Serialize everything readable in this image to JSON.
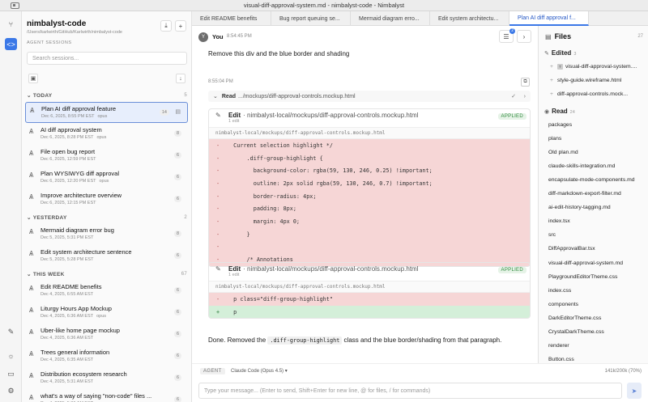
{
  "window": {
    "title": "visual-diff-approval-system.md - nimbalyst-code - Nimbalyst"
  },
  "rail": {
    "icons": [
      "workflow-icon",
      "code-icon",
      "edit-icon",
      "sun-icon",
      "feedback-icon",
      "gear-icon"
    ]
  },
  "sidebar": {
    "project_title": "nimbalyst-code",
    "project_path": "/Users/karlwirth/GitHub/Karlwirth/nimbalyst-code",
    "section_caption": "AGENT SESSIONS",
    "search_placeholder": "Search sessions...",
    "groups": [
      {
        "label": "TODAY",
        "count": "5",
        "sessions": [
          {
            "title": "Plan AI diff approval feature",
            "date": "Dec 6, 2025, 8:55 PM EST",
            "model": "opus",
            "badge": "14",
            "selected": true
          },
          {
            "title": "AI diff approval system",
            "date": "Dec 6, 2025, 8:28 PM EST",
            "model": "opus",
            "badge": "8"
          },
          {
            "title": "File open bug report",
            "date": "Dec 6, 2025, 12:59 PM EST",
            "model": "",
            "badge": "6"
          },
          {
            "title": "Plan WYSIWYG diff approval",
            "date": "Dec 6, 2025, 12:20 PM EST",
            "model": "opus",
            "badge": "6"
          },
          {
            "title": "Improve architecture overview",
            "date": "Dec 6, 2025, 12:15 PM EST",
            "model": "",
            "badge": "6"
          }
        ]
      },
      {
        "label": "YESTERDAY",
        "count": "2",
        "sessions": [
          {
            "title": "Mermaid diagram error bug",
            "date": "Dec 5, 2025, 5:31 PM EST",
            "model": "",
            "badge": "8"
          },
          {
            "title": "Edit system architecture sentence",
            "date": "Dec 5, 2025, 5:28 PM EST",
            "model": "",
            "badge": "6"
          }
        ]
      },
      {
        "label": "THIS WEEK",
        "count": "67",
        "sessions": [
          {
            "title": "Edit README benefits",
            "date": "Dec 4, 2025, 6:55 AM EST",
            "model": "",
            "badge": "6"
          },
          {
            "title": "Liturgy Hours App Mockup",
            "date": "Dec 4, 2025, 6:36 AM EST",
            "model": "opus",
            "badge": "6"
          },
          {
            "title": "Uber-like home page mockup",
            "date": "Dec 4, 2025, 6:36 AM EST",
            "model": "",
            "badge": "6"
          },
          {
            "title": "Trees general information",
            "date": "Dec 4, 2025, 6:35 AM EST",
            "model": "",
            "badge": "6"
          },
          {
            "title": "Distribution ecosystem research",
            "date": "Dec 4, 2025, 5:31 AM EST",
            "model": "",
            "badge": "6"
          },
          {
            "title": "what's a way of saying \"non-code\" files ...",
            "date": "Dec 4, 2025, 5:36 AM EST",
            "model": "",
            "badge": "6"
          }
        ]
      }
    ]
  },
  "tabs": [
    "Edit README benefits",
    "Bug report queuing se...",
    "Mermaid diagram erro...",
    "Edit system architectu...",
    "Plan AI diff approval f..."
  ],
  "chat": {
    "user_avatar": "Y",
    "user_name": "You",
    "user_time": "8:54:45 PM",
    "header_badge": "2",
    "user_message": "Remove this div and the blue border and shading",
    "assistant_time": "8:55:04 PM",
    "read": {
      "label": "Read",
      "path": ".../mockups/diff-approval-controls.mockup.html"
    },
    "edits": [
      {
        "label": "Edit",
        "path": "nimbalyst-local/mockups/diff-approval-controls.mockup.html",
        "sub": "1 edit",
        "status": "APPLIED",
        "file": "nimbalyst-local/mockups/diff-approval-controls.mockup.html",
        "lines": [
          {
            "t": "del",
            "s": "-",
            "c": "  Current selection highlight */"
          },
          {
            "t": "del",
            "s": "-",
            "c": "      .diff-group-highlight {"
          },
          {
            "t": "del",
            "s": "-",
            "c": "        background-color: rgba(59, 130, 246, 0.25) !important;"
          },
          {
            "t": "del",
            "s": "-",
            "c": "        outline: 2px solid rgba(59, 130, 246, 0.7) !important;"
          },
          {
            "t": "del",
            "s": "-",
            "c": "        border-radius: 4px;"
          },
          {
            "t": "del",
            "s": "-",
            "c": "        padding: 8px;"
          },
          {
            "t": "del",
            "s": "-",
            "c": "        margin: 4px 0;"
          },
          {
            "t": "del",
            "s": "-",
            "c": "      }"
          },
          {
            "t": "del",
            "s": "-",
            "c": ""
          },
          {
            "t": "del",
            "s": "-",
            "c": "      /* Annotations"
          }
        ]
      },
      {
        "label": "Edit",
        "path": "nimbalyst-local/mockups/diff-approval-controls.mockup.html",
        "sub": "1 edit",
        "status": "APPLIED",
        "file": "nimbalyst-local/mockups/diff-approval-controls.mockup.html",
        "lines": [
          {
            "t": "del",
            "s": "-",
            "c": "  p class=\"diff-group-highlight\""
          },
          {
            "t": "add",
            "s": "+",
            "c": "  p"
          }
        ]
      }
    ],
    "done_pre": "Done. Removed the ",
    "done_code": ".diff-group-highlight",
    "done_post": " class and the blue border/shading from that paragraph."
  },
  "agent_bar": {
    "tag": "AGENT",
    "model": "Claude Code (Opus 4.5) ▾",
    "tokens": "141k/200k (70%)"
  },
  "composer": {
    "placeholder": "Type your message... (Enter to send, Shift+Enter for new line, @ for files, / for commands)"
  },
  "files": {
    "title": "Files",
    "count": "27",
    "edited": {
      "label": "Edited",
      "count": "3",
      "items": [
        "visual-diff-approval-system....",
        "style-guide.wireframe.html",
        "diff-approval-controls.mock..."
      ]
    },
    "read": {
      "label": "Read",
      "count": "24",
      "items": [
        "packages",
        "plans",
        "Old plan.md",
        "claude-skills-integration.md",
        "encapsulate-mode-components.md",
        "diff-markdown-export-filter.md",
        "ai-edit-history-tagging.md",
        "index.tsx",
        "src",
        "DiffApprovalBar.tsx",
        "visual-diff-approval-system.md",
        "PlaygroundEditorTheme.css",
        "index.css",
        "components",
        "DarkEditorTheme.css",
        "CrystalDarkTheme.css",
        "renderer",
        "Button.css"
      ]
    }
  }
}
